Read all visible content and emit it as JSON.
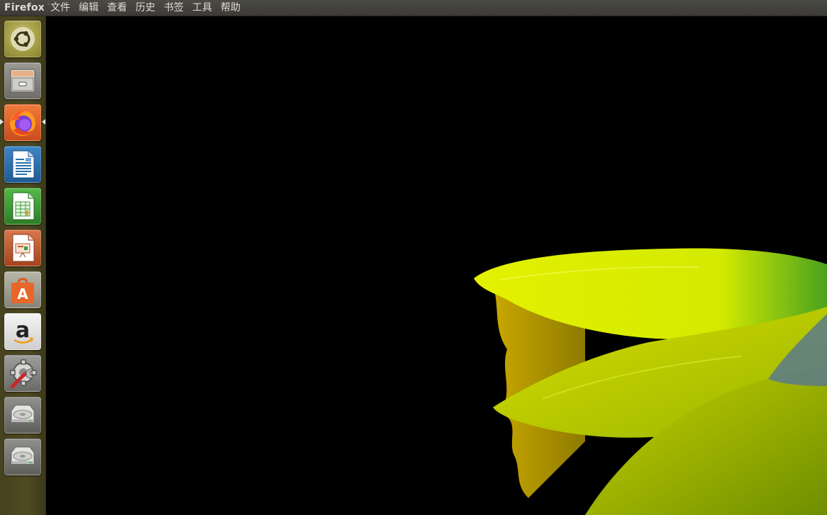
{
  "topbar": {
    "app_title": "Firefox Web Browser",
    "menu": [
      "文件",
      "编辑",
      "查看",
      "历史",
      "书签",
      "工具",
      "帮助"
    ]
  },
  "launcher": {
    "items": [
      {
        "name": "dash-home",
        "icon": "ubuntu-logo-icon",
        "color": "#9a9238"
      },
      {
        "name": "files",
        "icon": "file-cabinet-icon",
        "color": "#8a8a86"
      },
      {
        "name": "firefox",
        "icon": "firefox-icon",
        "color": "#e8622a",
        "active": true
      },
      {
        "name": "libreoffice-writer",
        "icon": "writer-document-icon",
        "color": "#2a6ea8"
      },
      {
        "name": "libreoffice-calc",
        "icon": "calc-spreadsheet-icon",
        "color": "#3e9a36"
      },
      {
        "name": "libreoffice-impress",
        "icon": "impress-presentation-icon",
        "color": "#c0562b"
      },
      {
        "name": "software-center",
        "icon": "shopping-bag-icon",
        "color": "#e05a1f"
      },
      {
        "name": "amazon",
        "icon": "amazon-icon",
        "color": "#f0f0f0"
      },
      {
        "name": "system-settings",
        "icon": "settings-wrench-icon",
        "color": "#8c8c8c"
      },
      {
        "name": "drive-1",
        "icon": "hard-drive-icon",
        "color": "#bcbcbc"
      },
      {
        "name": "drive-2",
        "icon": "hard-drive-icon",
        "color": "#bcbcbc"
      }
    ]
  },
  "desktop": {
    "wallpaper": "yellow-daffodil-flower",
    "colors": {
      "background": "#000000",
      "petal": "#d8e800",
      "petal_dark": "#a8b800",
      "stem": "#4e8a2a"
    }
  }
}
